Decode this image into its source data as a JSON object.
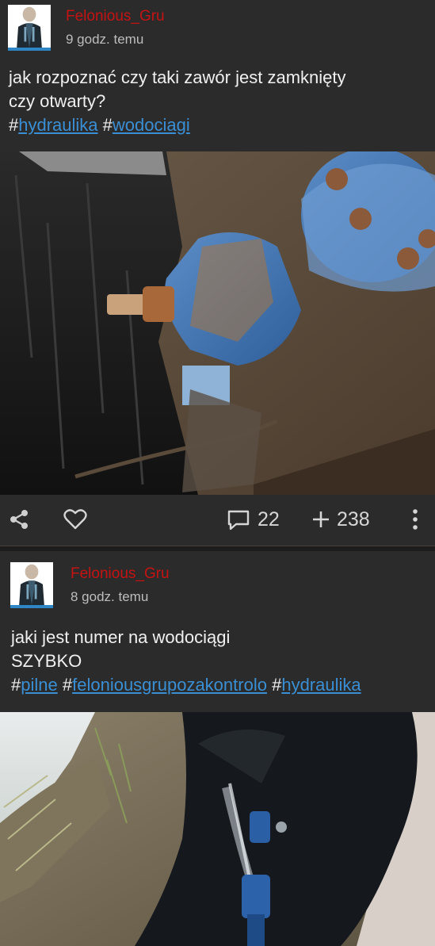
{
  "posts": [
    {
      "author": "Felonious_Gru",
      "time": "9 godz. temu",
      "text_lines": [
        "jak rozpoznać czy taki zawór jest zamknięty",
        "czy otwarty?"
      ],
      "tags": [
        "hydraulika",
        "wodociagi"
      ],
      "image_icon": "pipe-valve-photo",
      "actions": {
        "share_icon": "share-icon",
        "like_icon": "heart-icon",
        "comments_icon": "comment-icon",
        "comments_count": "22",
        "votes_icon": "plus-icon",
        "votes_count": "238",
        "more_icon": "more-vertical-icon"
      }
    },
    {
      "author": "Felonious_Gru",
      "time": "8 godz. temu",
      "text_lines": [
        "jaki jest numer na wodociągi",
        "SZYBKO"
      ],
      "tags": [
        "pilne",
        "feloniousgrupozakontrolo",
        "hydraulika"
      ],
      "image_icon": "leaking-pipe-photo"
    }
  ],
  "colors": {
    "background": "#2b2b2b",
    "username": "#c51313",
    "tag_link": "#3a8fd4",
    "avatar_underline": "#2f86c5"
  }
}
